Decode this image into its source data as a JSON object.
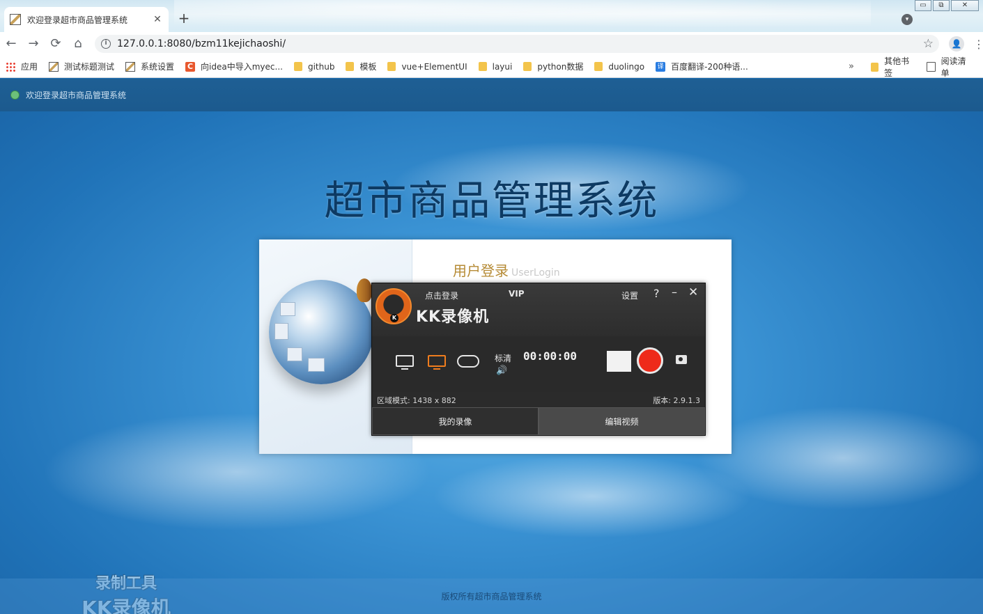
{
  "browser": {
    "tab_title": "欢迎登录超市商品管理系统",
    "tab_close": "✕",
    "new_tab": "+",
    "window_controls": [
      "▭",
      "⧉",
      "✕"
    ],
    "url": "127.0.0.1:8080/bzm11kejichaoshi/",
    "nav": {
      "back": "←",
      "forward": "→",
      "reload": "⟳",
      "home": "⌂",
      "info": "i",
      "star": "☆",
      "menu": "⋮",
      "account": "👤",
      "profile": "▾"
    },
    "bookmarks": [
      {
        "label": "应用",
        "icon": "apps-grid-icon"
      },
      {
        "label": "测试标题测试",
        "icon": "image-icon"
      },
      {
        "label": "系统设置",
        "icon": "image-icon"
      },
      {
        "label": "向idea中导入myec...",
        "icon": "c-icon"
      },
      {
        "label": "github",
        "icon": "folder-icon"
      },
      {
        "label": "模板",
        "icon": "folder-icon"
      },
      {
        "label": "vue+ElementUI",
        "icon": "folder-icon"
      },
      {
        "label": "layui",
        "icon": "folder-icon"
      },
      {
        "label": "python数据",
        "icon": "folder-icon"
      },
      {
        "label": "duolingo",
        "icon": "folder-icon"
      },
      {
        "label": "百度翻译-200种语...",
        "icon": "translate-icon"
      }
    ],
    "bookmarks_more": "»",
    "other_bookmarks": "其他书签",
    "reading_list": "阅读清单"
  },
  "page": {
    "header_text": "欢迎登录超市商品管理系统",
    "system_title": "超市商品管理系统",
    "login_heading": "用户登录",
    "login_heading_en": "UserLogin",
    "copyright": "版权所有超市商品管理系统",
    "watermark_line1": "录制工具",
    "watermark_line2": "KK录像机"
  },
  "recorder": {
    "brand": "KK录像机",
    "login": "点击登录",
    "vip": "VIP",
    "settings": "设置",
    "help": "?",
    "minimize": "–",
    "close": "✕",
    "quality": "标清",
    "timer": "00:00:00",
    "volume": "🔊",
    "region_mode": "区域模式: 1438 x 882",
    "version": "版本: 2.9.1.3",
    "tab_my_recordings": "我的录像",
    "tab_edit_video": "编辑视频",
    "colors": {
      "accent": "#f07d1e",
      "record": "#ee2a1a"
    }
  }
}
